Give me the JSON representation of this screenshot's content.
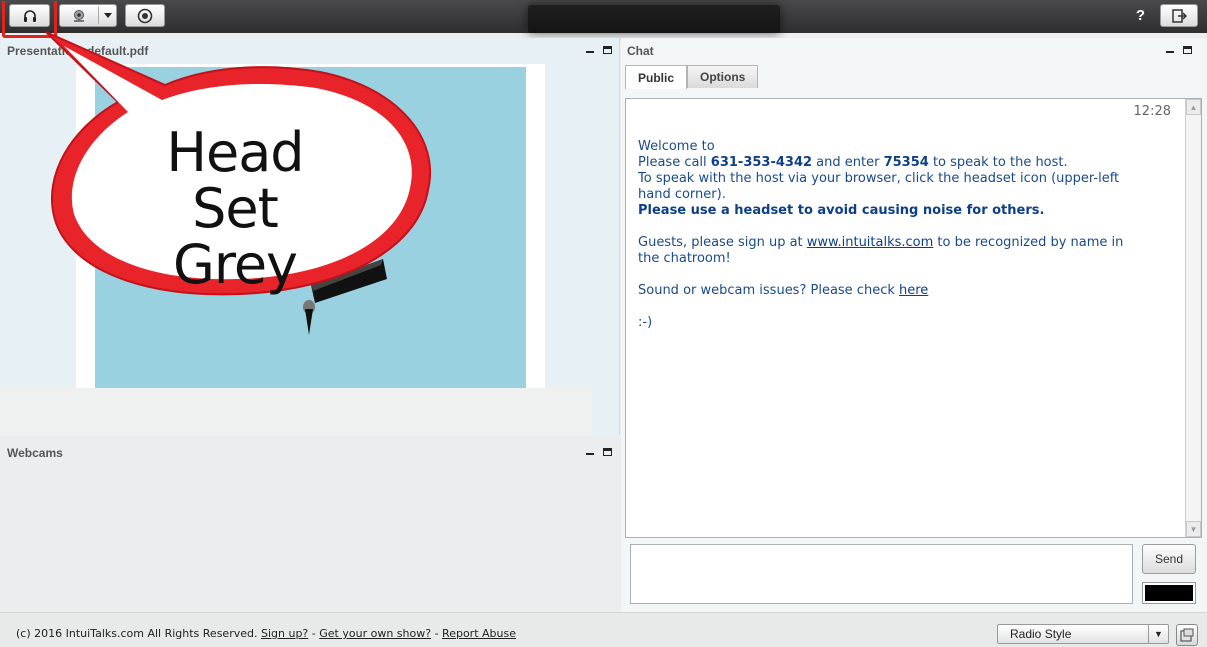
{
  "toolbar": {
    "headset_icon": "headset-icon",
    "webcam_icon": "webcam-icon",
    "record_icon": "record-icon",
    "help_label": "?",
    "exit_icon": "exit-icon"
  },
  "presentation": {
    "title": "Presentation: default.pdf"
  },
  "callout": {
    "line1": "Head Set",
    "line2": "Grey"
  },
  "webcams": {
    "title": "Webcams"
  },
  "chat": {
    "title": "Chat",
    "tabs": [
      {
        "label": "Public"
      },
      {
        "label": "Options"
      }
    ],
    "time": "12:28",
    "message": {
      "l1": "Welcome to",
      "l2a": " Please call ",
      "phone": "631-353-4342",
      "l2b": " and enter ",
      "code": "75354",
      "l2c": " to speak to the host.",
      "l3": "To speak with the host via your browser, click the headset icon (upper-left hand corner).",
      "l4": "Please use a headset to avoid causing noise for others.",
      "l5a": "Guests, please sign up at ",
      "link_site": "www.intuitalks.com",
      "l5b": " to be recognized by name in the chatroom!",
      "l6a": "Sound or webcam issues? Please check ",
      "link_here": "here",
      "l7": ":-)"
    },
    "send_label": "Send",
    "text_color": "#000000"
  },
  "footer": {
    "copyright": "(c) 2016 IntuiTalks.com All Rights Reserved.",
    "signup": "Sign up?",
    "sep": "-",
    "own_show": "Get your own show?",
    "report": "Report Abuse",
    "style_value": "Radio Style"
  }
}
